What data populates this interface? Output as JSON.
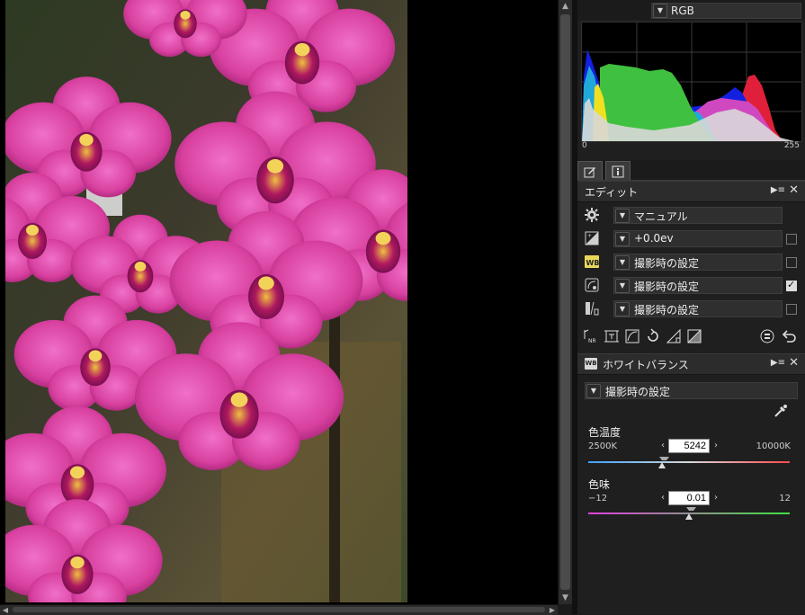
{
  "histogram": {
    "channel": "RGB",
    "min_label": "0",
    "max_label": "255"
  },
  "panel_tabs": [
    {
      "icon": "edit-icon"
    },
    {
      "icon": "info-icon"
    }
  ],
  "edit_section": {
    "title": "エディット",
    "rows": [
      {
        "icon": "gear-icon",
        "value": "マニュアル",
        "has_checkbox": false
      },
      {
        "icon": "exposure-icon",
        "value": "+0.0ev",
        "has_checkbox": true,
        "checked": false
      },
      {
        "icon": "wb-icon",
        "value": "撮影時の設定",
        "has_checkbox": true,
        "checked": false
      },
      {
        "icon": "picture-control-icon",
        "value": "撮影時の設定",
        "has_checkbox": true,
        "checked": true
      },
      {
        "icon": "tone-icon",
        "value": "撮影時の設定",
        "has_checkbox": true,
        "checked": false
      }
    ],
    "tools": [
      "noise-reduction-icon",
      "crop-icon",
      "lens-correction-icon",
      "rotate-icon",
      "straighten-icon",
      "levels-icon",
      "reset-icon",
      "undo-icon"
    ]
  },
  "wb_section": {
    "title": "ホワイトバランス",
    "badge": "WB",
    "preset": "撮影時の設定",
    "temperature": {
      "label": "色温度",
      "min_label": "2500K",
      "max_label": "10000K",
      "value": "5242",
      "min": 2500,
      "max": 10000,
      "current": 5242
    },
    "tint": {
      "label": "色味",
      "min_label": "−12",
      "max_label": "12",
      "value": "0.01",
      "min": -12,
      "max": 12,
      "current": 0.01
    }
  },
  "colors": {
    "accent_tint": "#e040e0",
    "temp_start": "#3da0ff",
    "temp_end": "#ff4a4a"
  }
}
